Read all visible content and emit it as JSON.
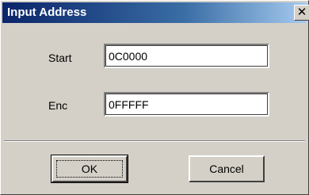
{
  "window": {
    "title": "Input Address",
    "close_symbol": "✕",
    "close_icon": "close-icon"
  },
  "fields": {
    "start": {
      "label": "Start",
      "value": "0C0000"
    },
    "end": {
      "label": "Enc",
      "value": "0FFFFF"
    }
  },
  "buttons": {
    "ok_label": "OK",
    "cancel_label": "Cancel"
  },
  "colors": {
    "face": "#d4d0c8",
    "titlebar_start": "#0a246a",
    "titlebar_end": "#a6caf0"
  }
}
